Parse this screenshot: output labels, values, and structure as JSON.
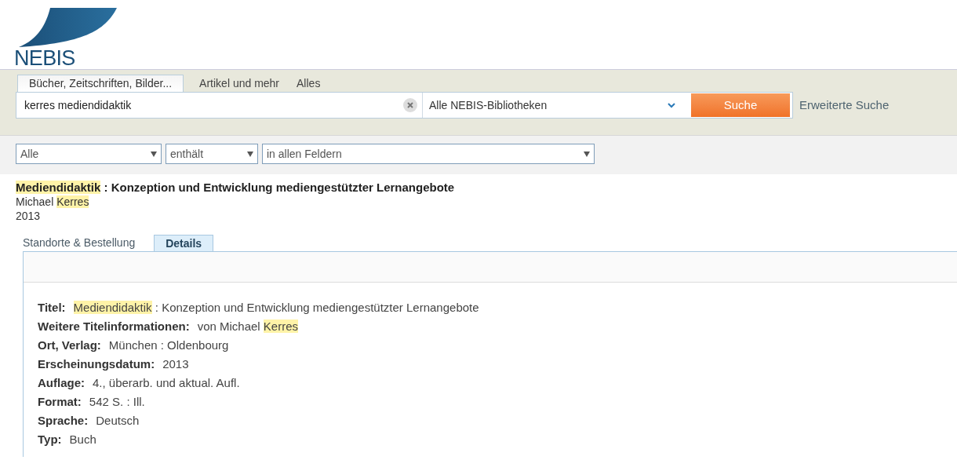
{
  "logo": {
    "text": "NEBIS"
  },
  "search_tabs": [
    {
      "label": "Bücher, Zeitschriften, Bilder...",
      "selected": true
    },
    {
      "label": "Artikel und mehr",
      "selected": false
    },
    {
      "label": "Alles",
      "selected": false
    }
  ],
  "search": {
    "value": "kerres mediendidaktik",
    "scope": "Alle NEBIS-Bibliotheken",
    "button": "Suche",
    "advanced_link": "Erweiterte Suche"
  },
  "filters": [
    {
      "value": "Alle"
    },
    {
      "value": "enthält"
    },
    {
      "value": "in allen Feldern"
    }
  ],
  "result": {
    "title": [
      {
        "text": "Mediendidaktik",
        "highlight": true
      },
      {
        "text": " : Konzeption und Entwicklung mediengestützter Lernangebote",
        "highlight": false
      }
    ],
    "author": [
      {
        "text": "Michael ",
        "highlight": false
      },
      {
        "text": "Kerres",
        "highlight": true
      }
    ],
    "year": "2013"
  },
  "detail_tabs": [
    {
      "label": "Standorte & Bestellung",
      "selected": false
    },
    {
      "label": "Details",
      "selected": true
    }
  ],
  "details": [
    {
      "label": "Titel:",
      "value": [
        {
          "text": "Mediendidaktik",
          "highlight": true
        },
        {
          "text": " : Konzeption und Entwicklung mediengestützter Lernangebote",
          "highlight": false
        }
      ]
    },
    {
      "label": "Weitere Titelinformationen:",
      "value": [
        {
          "text": "von Michael ",
          "highlight": false
        },
        {
          "text": "Kerres",
          "highlight": true
        }
      ]
    },
    {
      "label": "Ort, Verlag:",
      "value": [
        {
          "text": "München : Oldenbourg",
          "highlight": false
        }
      ]
    },
    {
      "label": "Erscheinungsdatum:",
      "value": [
        {
          "text": "2013",
          "highlight": false
        }
      ]
    },
    {
      "label": "Auflage:",
      "value": [
        {
          "text": "4., überarb. und aktual. Aufl.",
          "highlight": false
        }
      ]
    },
    {
      "label": "Format:",
      "value": [
        {
          "text": "542 S. : Ill.",
          "highlight": false
        }
      ]
    },
    {
      "label": "Sprache:",
      "value": [
        {
          "text": "Deutsch",
          "highlight": false
        }
      ]
    },
    {
      "label": "Typ:",
      "value": [
        {
          "text": "Buch",
          "highlight": false
        }
      ]
    }
  ]
}
